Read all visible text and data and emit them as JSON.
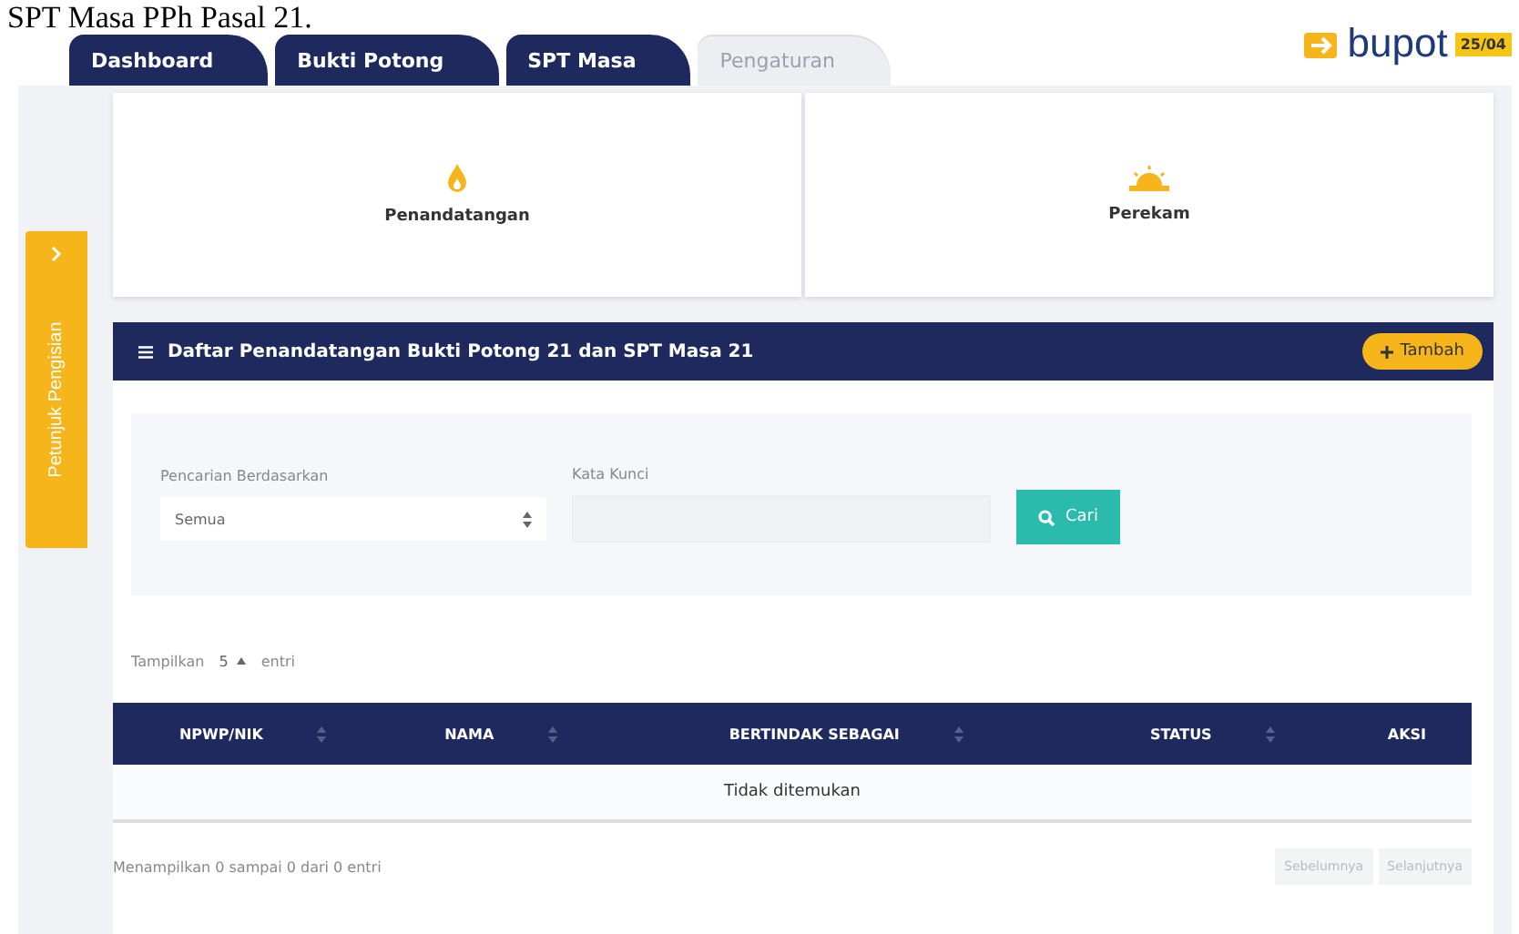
{
  "caption_above": "SPT Masa PPh Pasal 21.",
  "tabs": [
    {
      "label": "Dashboard",
      "selected": false
    },
    {
      "label": "Bukti Potong",
      "selected": false
    },
    {
      "label": "SPT Masa",
      "selected": false
    },
    {
      "label": "Pengaturan",
      "selected": true
    }
  ],
  "logo": {
    "text": "bupot",
    "badge": "25/04"
  },
  "side_panel": {
    "label": "Petunjuk Pengisian"
  },
  "menu_cards": [
    {
      "kind": "sign",
      "label": "Penandatangan"
    },
    {
      "kind": "recorder",
      "label": "Perekam"
    }
  ],
  "list_panel": {
    "title": "Daftar Penandatangan Bukti Potong 21 dan SPT Masa 21",
    "add_button": "Tambah"
  },
  "filter": {
    "search_by_label": "Pencarian Berdasarkan",
    "search_by_value": "Semua",
    "keyword_label": "Kata Kunci",
    "search_button": "Cari"
  },
  "page_size": {
    "prefix": "Tampilkan",
    "value": "5",
    "suffix": "entri"
  },
  "table": {
    "columns": [
      {
        "label": "NPWP/NIK",
        "sortable": true
      },
      {
        "label": "NAMA",
        "sortable": true
      },
      {
        "label": "BERTINDAK SEBAGAI",
        "sortable": true
      },
      {
        "label": "STATUS",
        "sortable": true
      },
      {
        "label": "AKSI",
        "sortable": false
      }
    ],
    "empty_message": "Tidak ditemukan"
  },
  "footer": {
    "info": "Menampilkan 0 sampai 0 dari 0 entri",
    "buttons": [
      {
        "label": "Sebelumnya",
        "disabled": true
      },
      {
        "label": "Selanjutnya",
        "disabled": true
      }
    ]
  }
}
